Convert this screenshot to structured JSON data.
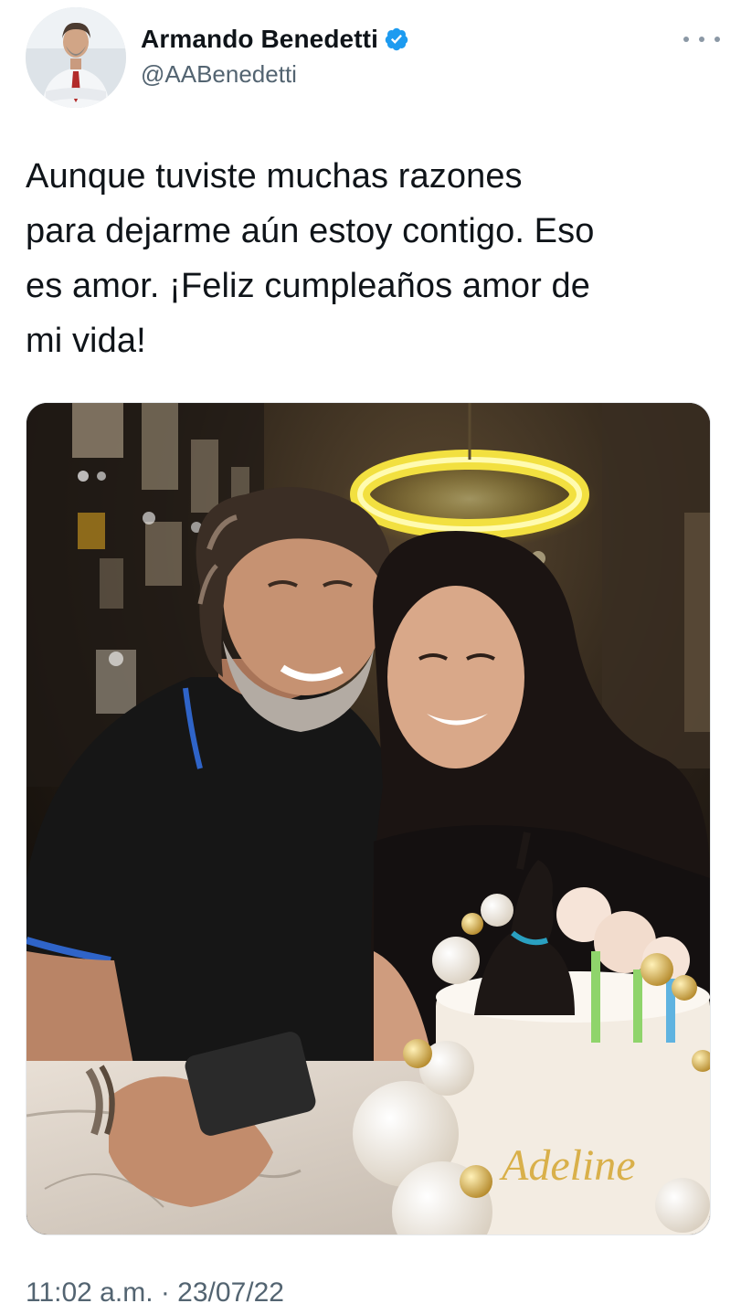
{
  "tweet": {
    "author": {
      "name": "Armando Benedetti",
      "handle": "@AABenedetti",
      "verified": true,
      "verified_color": "#1d9bf0"
    },
    "text": "Aunque tuviste muchas razones\npara dejarme aún estoy contigo. Eso\nes amor. ¡Feliz cumpleaños amor de\nmi vida!",
    "media": {
      "cake_inscription": "Adeline"
    },
    "timestamp": "11:02 a.m. · 23/07/22"
  },
  "icons": {
    "more": "more-horizontal-icon",
    "verified": "verified-badge-icon"
  },
  "colors": {
    "text_primary": "#0f1419",
    "text_secondary": "#536471",
    "accent": "#1d9bf0"
  }
}
